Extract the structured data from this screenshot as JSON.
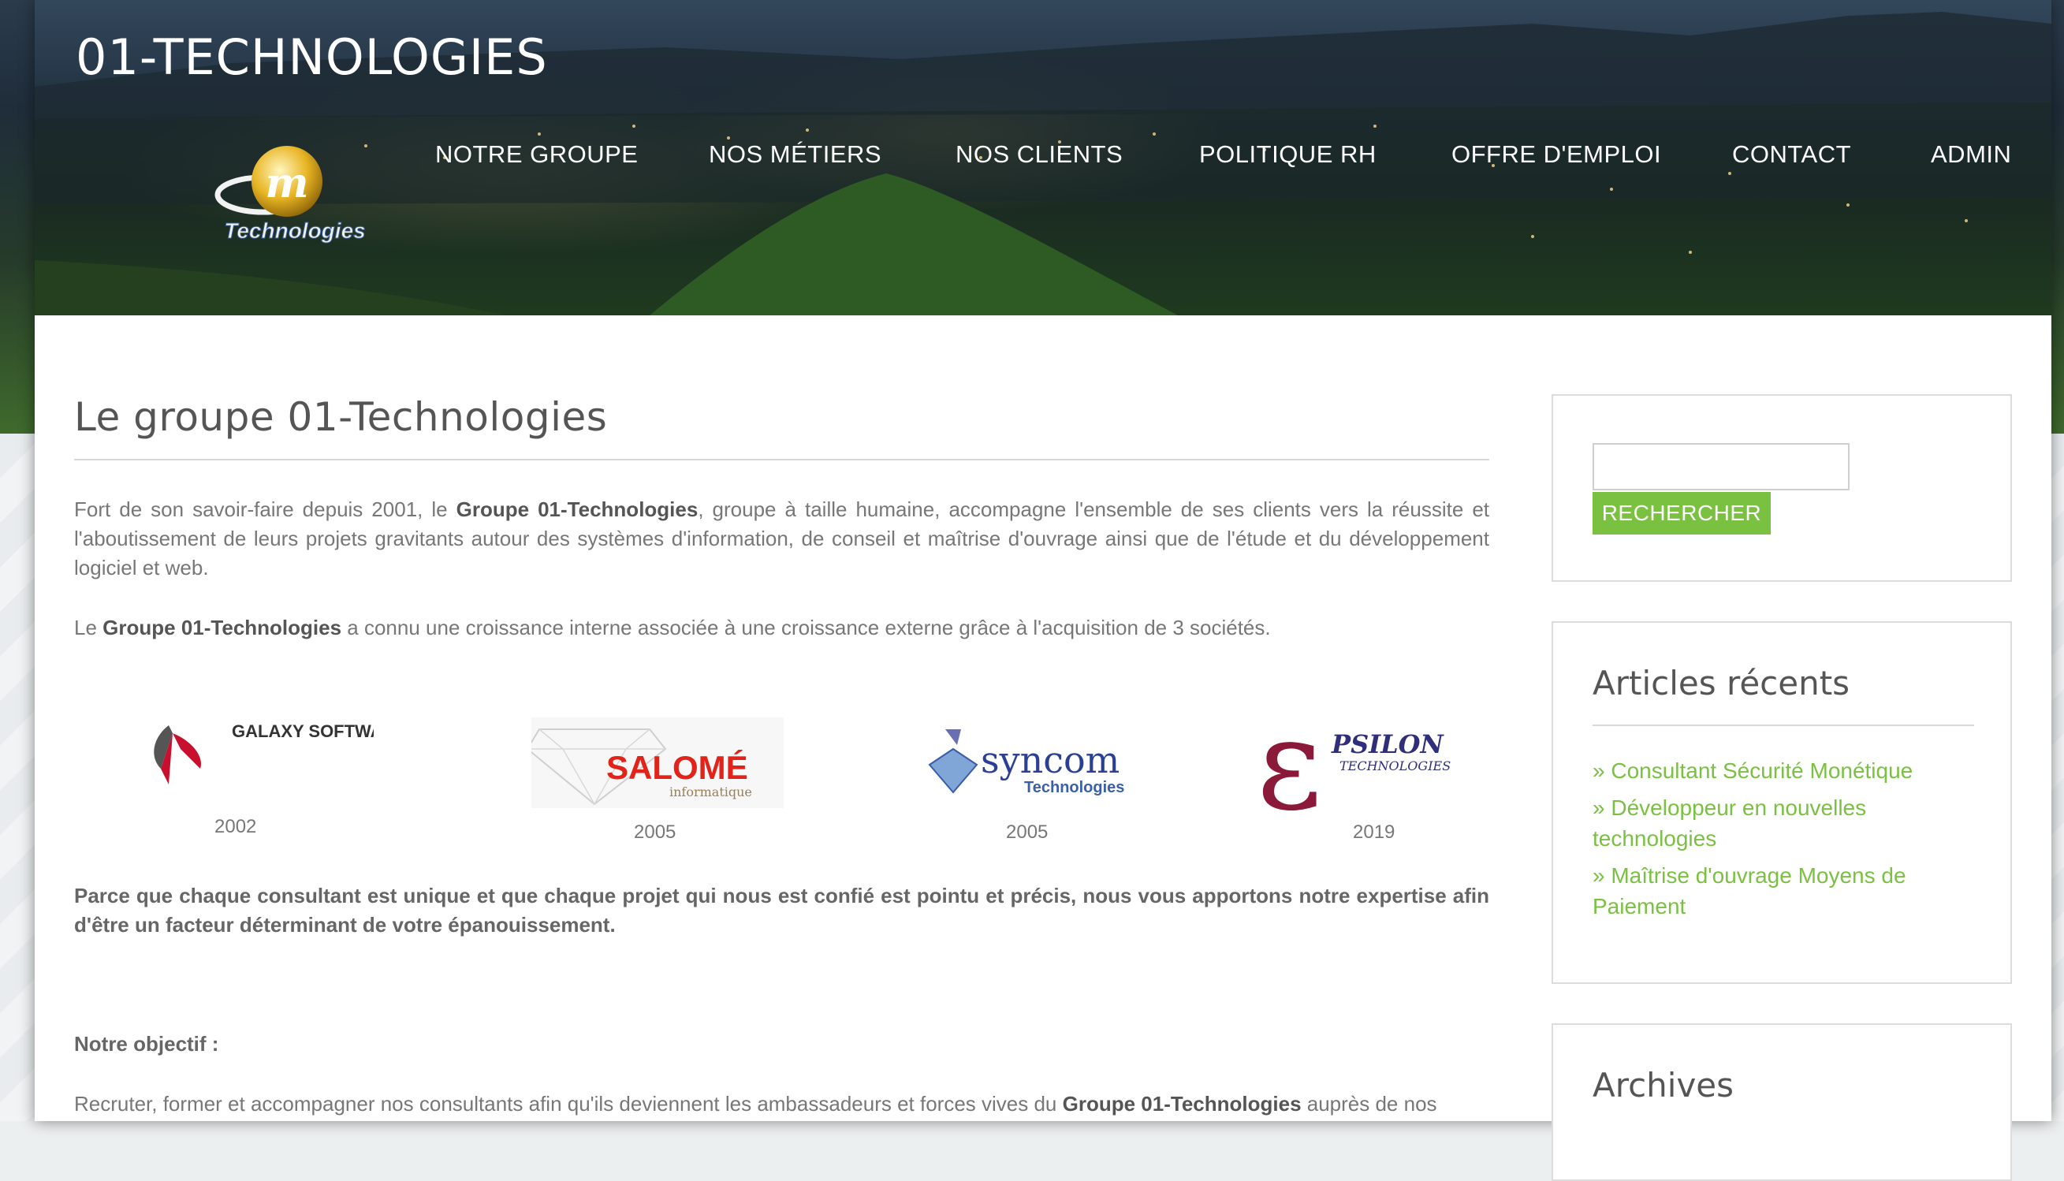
{
  "site": {
    "title": "01-TECHNOLOGIES",
    "logo_text": "Technologies",
    "logo_mark": "m"
  },
  "nav": {
    "items": [
      "NOTRE GROUPE",
      "NOS MÉTIERS",
      "NOS CLIENTS",
      "POLITIQUE RH",
      "OFFRE D'EMPLOI",
      "CONTACT",
      "ADMIN"
    ]
  },
  "main": {
    "title": "Le groupe 01-Technologies",
    "p1_before": "Fort de son savoir-faire depuis 2001, le ",
    "p1_bold": "Groupe 01-Technologies",
    "p1_after": ", groupe à taille humaine, accompagne l'ensemble de ses clients vers la réussite et l'aboutissement de leurs projets gravitants autour des systèmes d'information, de conseil et maîtrise d'ouvrage ainsi que de l'étude et du développement logiciel et web.",
    "p2_before": "Le ",
    "p2_bold": "Groupe 01-Technologies",
    "p2_after": " a connu une croissance interne associée à une croissance externe grâce à l'acquisition de 3 sociétés.",
    "companies": [
      {
        "name": "GALAXY SOFTWARE",
        "year": "2002"
      },
      {
        "name": "SALOMÉ",
        "sub": "informatique",
        "year": "2005"
      },
      {
        "name": "syncom",
        "sub": "Technologies",
        "year": "2005"
      },
      {
        "name": "PSILON",
        "sub": "TECHNOLOGIES",
        "year": "2019"
      }
    ],
    "p3": "Parce que chaque consultant est unique et que chaque projet qui nous est confié est pointu et précis, nous vous apportons notre expertise afin d'être un facteur déterminant de votre épanouissement.",
    "p4": "Notre objectif :",
    "p5_before": "Recruter, former et accompagner nos consultants afin qu'ils deviennent les ambassadeurs et forces vives du ",
    "p5_bold": "Groupe 01-Technologies",
    "p5_after": " auprès de nos"
  },
  "sidebar": {
    "search": {
      "value": "",
      "button_label": "RECHERCHER"
    },
    "recent": {
      "title": "Articles récents",
      "items": [
        "» Consultant Sécurité Monétique",
        "» Développeur en nouvelles technologies",
        "» Maîtrise d'ouvrage Moyens de Paiement"
      ]
    },
    "archives": {
      "title": "Archives"
    }
  },
  "colors": {
    "accent": "#7ac142",
    "text": "#777777",
    "heading": "#555555"
  }
}
